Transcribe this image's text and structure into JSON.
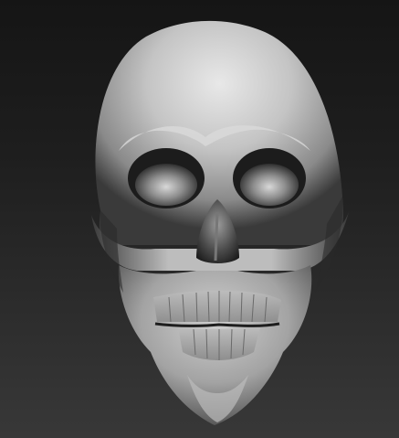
{
  "scene": {
    "subject": "skull-sculpt",
    "colors": {
      "background_top": "#151515",
      "background_bottom": "#383838",
      "material_light": "#e6e6e6",
      "material_mid": "#9a9a9a",
      "material_dark": "#2a2a2a"
    }
  }
}
